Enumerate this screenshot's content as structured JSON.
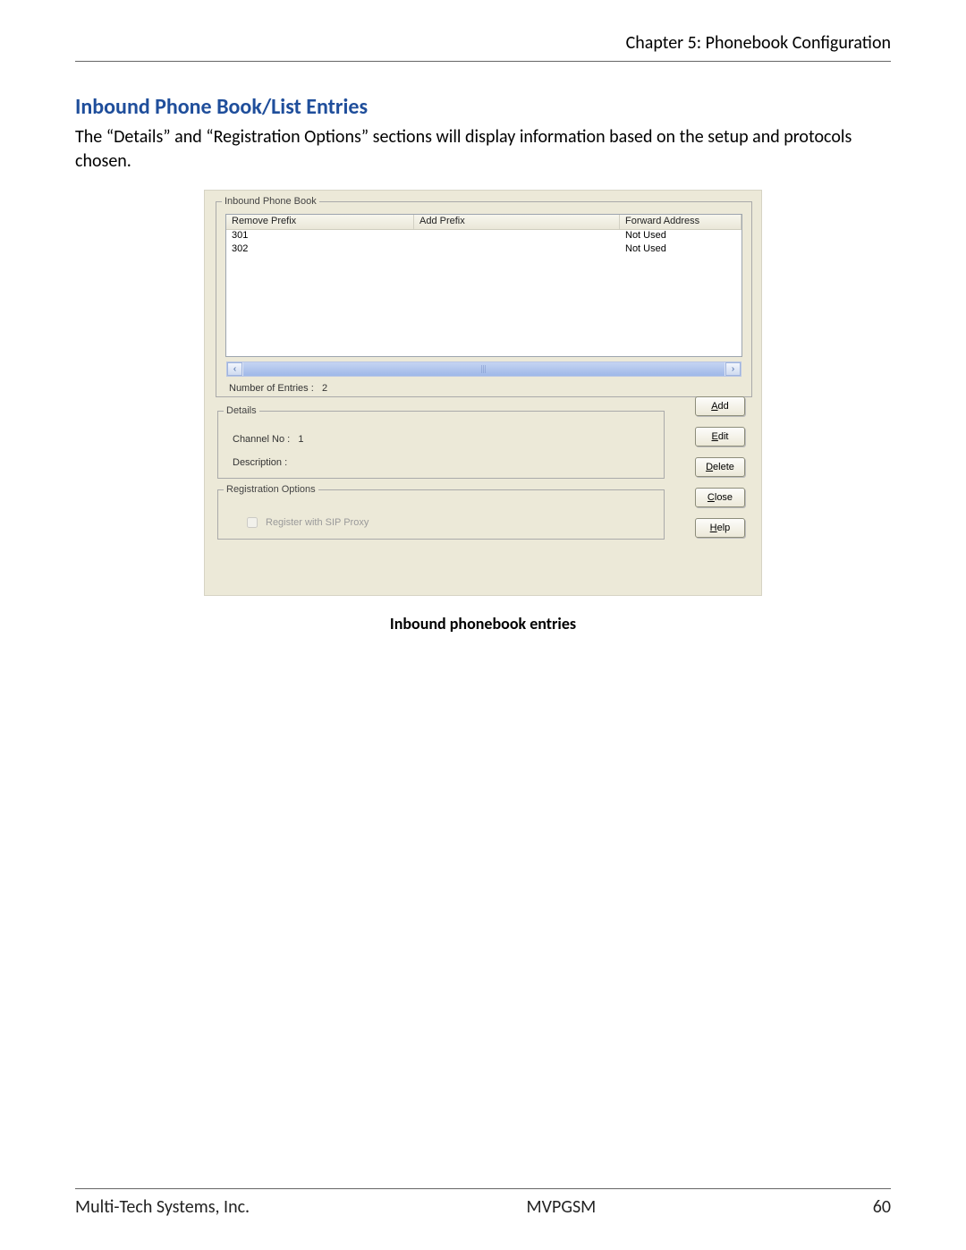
{
  "chapter_header": "Chapter 5: Phonebook Configuration",
  "section_title": "Inbound Phone Book/List Entries",
  "body_paragraph": "The “Details” and “Registration Options” sections will display information based on the setup and protocols chosen.",
  "dialog": {
    "phonebook_legend": "Inbound  Phone Book",
    "columns": {
      "remove": "Remove Prefix",
      "add": "Add Prefix",
      "forward": "Forward Address"
    },
    "rows": [
      {
        "remove": "301",
        "add": "",
        "forward": "Not Used"
      },
      {
        "remove": "302",
        "add": "",
        "forward": "Not Used"
      }
    ],
    "entries_label": "Number of Entries :",
    "entries_value": "2",
    "details_legend": "Details",
    "channel_label": "Channel No :",
    "channel_value": "1",
    "description_label": "Description :",
    "regopt_legend": "Registration Options",
    "register_sip_label": "Register with SIP Proxy",
    "buttons": {
      "add": {
        "pre": "",
        "u": "A",
        "post": "dd"
      },
      "edit": {
        "pre": "",
        "u": "E",
        "post": "dit"
      },
      "delete": {
        "pre": "",
        "u": "D",
        "post": "elete"
      },
      "close": {
        "pre": "",
        "u": "C",
        "post": "lose"
      },
      "help": {
        "pre": "",
        "u": "H",
        "post": "elp"
      }
    }
  },
  "caption": "Inbound phonebook entries",
  "footer": {
    "left": "Multi-Tech Systems, Inc.",
    "center": "MVPGSM",
    "right": "60"
  }
}
